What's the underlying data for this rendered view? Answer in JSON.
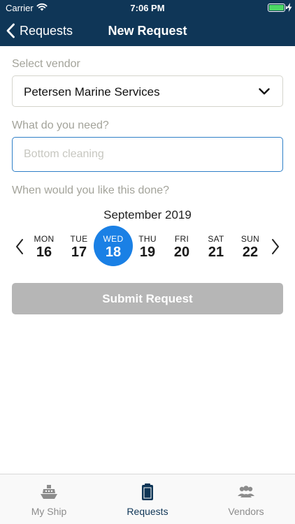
{
  "status_bar": {
    "carrier": "Carrier",
    "time": "7:06 PM"
  },
  "nav": {
    "back_label": "Requests",
    "title": "New Request"
  },
  "form": {
    "vendor_label": "Select vendor",
    "vendor_value": "Petersen Marine Services",
    "need_label": "What do you need?",
    "need_placeholder": "Bottom cleaning",
    "need_value": "",
    "when_label": "When would you like this done?"
  },
  "calendar": {
    "month": "September 2019",
    "days": [
      {
        "dow": "MON",
        "num": "16"
      },
      {
        "dow": "TUE",
        "num": "17"
      },
      {
        "dow": "WED",
        "num": "18",
        "selected": true
      },
      {
        "dow": "THU",
        "num": "19"
      },
      {
        "dow": "FRI",
        "num": "20"
      },
      {
        "dow": "SAT",
        "num": "21"
      },
      {
        "dow": "SUN",
        "num": "22"
      }
    ]
  },
  "submit_label": "Submit Request",
  "tabs": [
    {
      "label": "My Ship",
      "icon": "ship-icon"
    },
    {
      "label": "Requests",
      "icon": "clipboard-icon",
      "active": true
    },
    {
      "label": "Vendors",
      "icon": "people-icon"
    }
  ],
  "colors": {
    "nav_background": "#0f3657",
    "accent": "#1a80e5",
    "input_border": "#2f7fc7",
    "submit_disabled": "#b6b6b6",
    "battery": "#4cd964"
  }
}
